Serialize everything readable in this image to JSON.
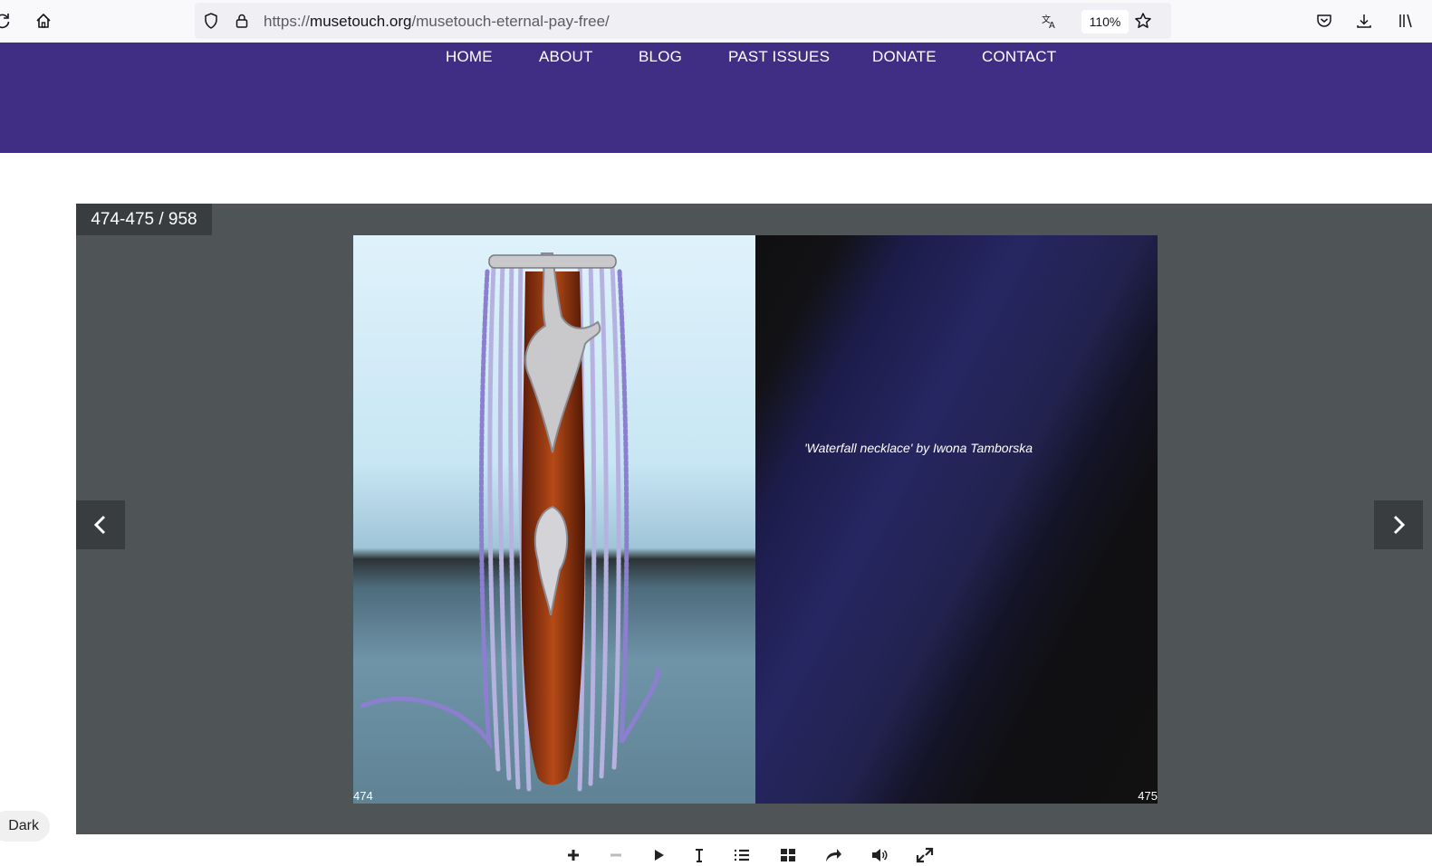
{
  "browser": {
    "url_prefix": "https://",
    "url_domain": "musetouch.org",
    "url_path": "/musetouch-eternal-pay-free/",
    "zoom": "110%"
  },
  "nav": {
    "items": [
      "HOME",
      "ABOUT",
      "BLOG",
      "PAST ISSUES",
      "DONATE",
      "CONTACT"
    ]
  },
  "flipbook": {
    "page_counter": "474-475 / 958",
    "caption": "'Waterfall necklace' by Iwona Tamborska",
    "left_page_number": "474",
    "right_page_number": "475"
  },
  "controls": [
    "zoom-in-icon",
    "zoom-out-icon",
    "play-icon",
    "text-icon",
    "list-icon",
    "grid-icon",
    "share-icon",
    "sound-icon",
    "fullscreen-icon"
  ],
  "dark_toggle": "Dark"
}
